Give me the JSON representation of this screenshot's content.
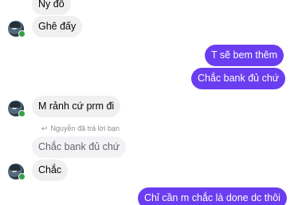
{
  "conversation": {
    "messages": [
      {
        "text": "Ny đồ",
        "direction": "incoming"
      },
      {
        "text": "Ghê đấy",
        "direction": "incoming"
      },
      {
        "text": "T sẽ bem thêm",
        "direction": "outgoing"
      },
      {
        "text": "Chắc bank đủ chứ",
        "direction": "outgoing"
      },
      {
        "text": "M rảnh cứ prm đi",
        "direction": "incoming"
      },
      {
        "text": "Chắc bank đủ chứ",
        "direction": "quoted-reply"
      },
      {
        "text": "Chắc",
        "direction": "incoming"
      },
      {
        "text": "Chỉ cần m chắc là done dc thôi",
        "direction": "outgoing"
      }
    ],
    "reply_note": "Nguyễn đã trả lời bạn",
    "reply_icon": "reply-arrow-icon",
    "avatar_icon": "user-avatar",
    "online_indicator_color": "#31a24c",
    "outgoing_color": "#6a3ef0",
    "incoming_color": "#f0f0f0"
  }
}
